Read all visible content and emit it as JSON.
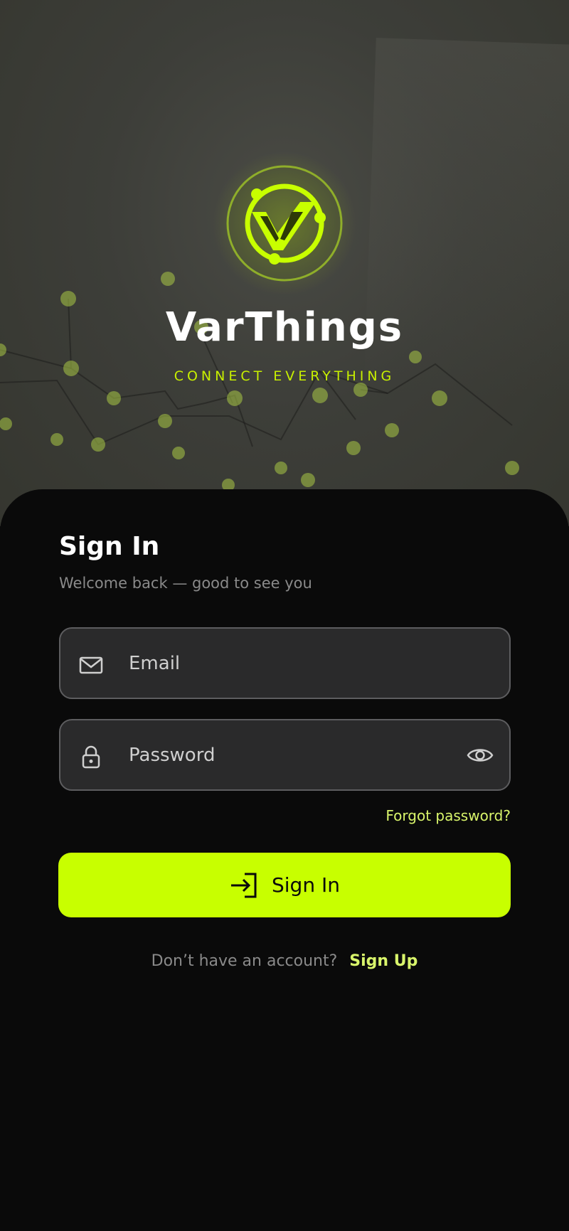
{
  "colors": {
    "accent": "#c8ff00",
    "accent_text": "#d9f56b",
    "background": "#0a0a0a",
    "field_background": "#2a2a2b",
    "field_border": "#5d5d5f",
    "muted_text": "#8a8a8a"
  },
  "brand": {
    "logo_icon": "varthings-logo-icon",
    "name": "VarThings",
    "tagline": "CONNECT EVERYTHING"
  },
  "signin": {
    "title": "Sign In",
    "subtitle": "Welcome back — good to see you",
    "email": {
      "icon": "mail-icon",
      "placeholder": "Email",
      "value": ""
    },
    "password": {
      "icon": "lock-icon",
      "placeholder": "Password",
      "value": "",
      "toggle_icon": "eye-icon"
    },
    "forgot_link": "Forgot password?",
    "submit": {
      "icon": "login-icon",
      "label": "Sign In"
    },
    "signup_prompt": "Don’t have an account?",
    "signup_link": "Sign Up"
  }
}
